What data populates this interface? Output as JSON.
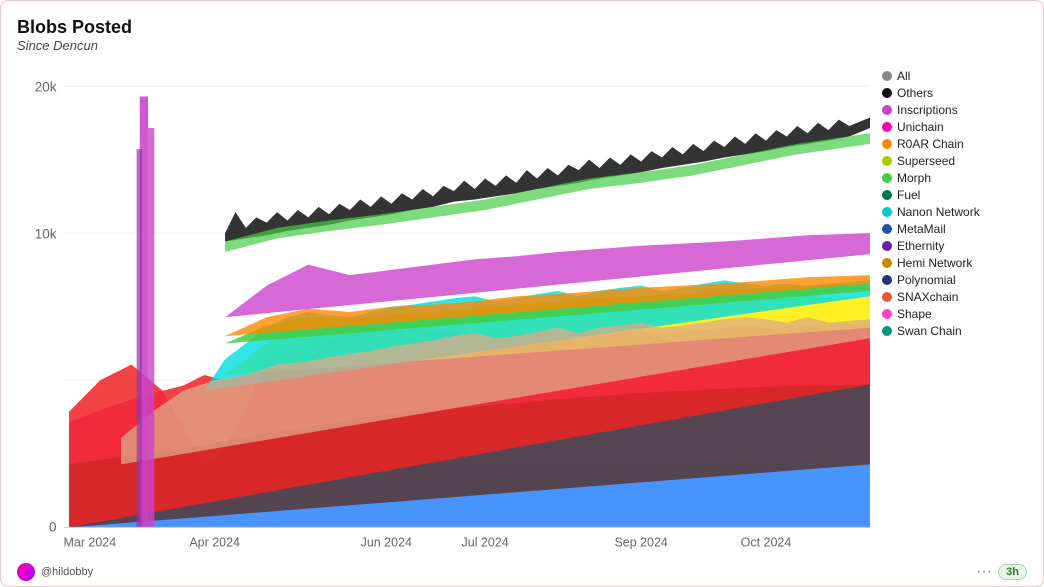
{
  "header": {
    "title": "Blobs Posted",
    "subtitle": "Since Dencun"
  },
  "footer": {
    "author": "@hildobby",
    "refresh": "3h"
  },
  "legend": {
    "items": [
      {
        "label": "All",
        "color": "#888888"
      },
      {
        "label": "Others",
        "color": "#111111"
      },
      {
        "label": "Inscriptions",
        "color": "#cc44cc"
      },
      {
        "label": "Unichain",
        "color": "#ff00aa"
      },
      {
        "label": "R0AR Chain",
        "color": "#ff8800"
      },
      {
        "label": "Superseed",
        "color": "#aacc00"
      },
      {
        "label": "Morph",
        "color": "#44cc44"
      },
      {
        "label": "Fuel",
        "color": "#007755"
      },
      {
        "label": "Nanon Network",
        "color": "#00cccc"
      },
      {
        "label": "MetaMail",
        "color": "#2255aa"
      },
      {
        "label": "Ethernity",
        "color": "#6622aa"
      },
      {
        "label": "Hemi Network",
        "color": "#cc8800"
      },
      {
        "label": "Polynomial",
        "color": "#223388"
      },
      {
        "label": "SNAXchain",
        "color": "#ee5533"
      },
      {
        "label": "Shape",
        "color": "#ff44bb"
      },
      {
        "label": "Swan Chain",
        "color": "#009988"
      }
    ]
  },
  "yaxis": {
    "labels": [
      "0",
      "10k",
      "20k"
    ],
    "values": [
      0,
      10000,
      20000
    ]
  },
  "xaxis": {
    "labels": [
      "Mar 2024",
      "Apr 2024",
      "Jun 2024",
      "Jul 2024",
      "Sep 2024",
      "Oct 2024"
    ]
  }
}
